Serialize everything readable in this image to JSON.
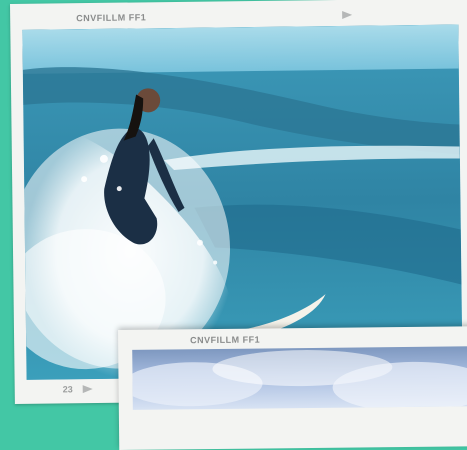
{
  "frames": {
    "main": {
      "label": "CNVFILLM FF1",
      "number": "23"
    },
    "second": {
      "label": "CNVFILLM FF1"
    }
  },
  "colors": {
    "background": "#43c7a5",
    "frame_paper": "#f3f4f2",
    "sea": "#3d9ab9",
    "sky": "#bfe3ef"
  },
  "icons": {
    "film_arrow": "arrow-right-icon"
  }
}
